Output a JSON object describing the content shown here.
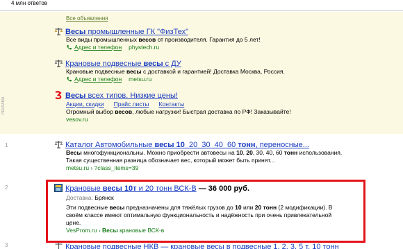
{
  "header": {
    "answers_count": "4 млн ответов"
  },
  "ads": {
    "all_ads_label": "Все объявления",
    "side_label": "РЕКЛАМА",
    "items": [
      {
        "title_pre": "",
        "title_bold": "Весы",
        "title_post": " промышленные ГК \"ФизТех\"",
        "snippet": "Все виды промышленных весов от производителя. Гарантия до 5 лет!",
        "contact_label": "Адрес и телефон",
        "domain": "phystech.ru"
      },
      {
        "title_pre": "Крановые подвесные ",
        "title_bold": "весы",
        "title_post": " с ДУ",
        "snippet": "Крановые подвесные весы с доставкой и гарантией! Доставка Москва, Россия.",
        "contact_label": "Адрес и телефон",
        "domain": "metsu.ru"
      },
      {
        "title_pre": "",
        "title_bold": "Весы",
        "title_post": " всех типов. Низкие цены!",
        "sitelinks": [
          "Акции, скидки",
          "Прайс листы",
          "Контакты"
        ],
        "snippet": "Огромный выбор весов, любые нагрузки! Быстрая доставка по РФ! Заказывайте!",
        "domain": "vesov.ru"
      }
    ]
  },
  "results": [
    {
      "number": "1",
      "title": "Каталог Автомобильные весы 10  20  30  40  60 тонн, переносные...",
      "snippet_lines": [
        "Весы многофункциональны. Можно приобрести автовесы на 10, 20, 30, 40, 60 тонн использования.",
        "Такая существенная разница обозначает вес, который может быть принят..."
      ],
      "url": "metsu.ru › ?class_items=39"
    },
    {
      "number": "2",
      "title": "Крановые весы 10т и 20 тонн ВСК-В",
      "price": " — 36 000 руб.",
      "delivery_label": "Доставка:",
      "delivery_value": "Брянск",
      "snippet_lines": [
        "Эти подвесные весы предназначены для тяжёлых грузов до 10 или 20 тонн (2 модификации). В",
        "своём классе имеют оптимальную функциональность и надёжность при очень привлекательной",
        "цене."
      ],
      "url_domain": "VesProm.ru",
      "url_path": "Весы крановые ВСК-в"
    },
    {
      "number": "3",
      "title": "Крановые подвесные НКВ — крановые весы в подвесные 1, 2, 3, 5 т, 10 тонн"
    }
  ]
}
